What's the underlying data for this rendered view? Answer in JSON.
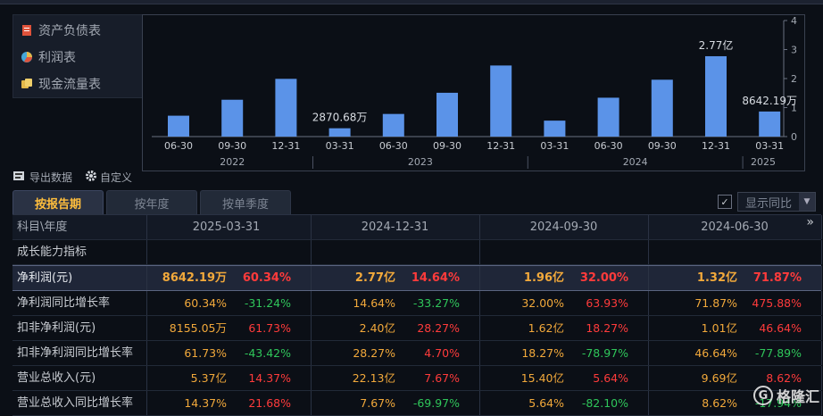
{
  "sidebar": {
    "items": [
      {
        "label": "资产负债表",
        "icon": "balance-sheet-icon",
        "color": "#e0533b"
      },
      {
        "label": "利润表",
        "icon": "income-statement-icon",
        "color": "#43a6d8"
      },
      {
        "label": "现金流量表",
        "icon": "cash-flow-icon",
        "color": "#e3b84a"
      }
    ]
  },
  "toolbar": {
    "export_label": "导出数据",
    "customize_label": "自定义"
  },
  "tabs": [
    {
      "label": "按报告期",
      "active": true
    },
    {
      "label": "按年度",
      "active": false
    },
    {
      "label": "按单季度",
      "active": false
    }
  ],
  "yoy": {
    "checked": true,
    "label": "显示同比"
  },
  "chart_data": {
    "type": "bar",
    "categories": [
      "06-30",
      "09-30",
      "12-31",
      "03-31",
      "06-30",
      "09-30",
      "12-31",
      "03-31",
      "06-30",
      "09-30",
      "12-31",
      "03-31"
    ],
    "years": [
      "2022",
      "2023",
      "2024",
      "2025"
    ],
    "values": [
      0.72,
      1.27,
      1.99,
      0.287,
      0.78,
      1.51,
      2.45,
      0.55,
      1.34,
      1.96,
      2.77,
      0.864
    ],
    "data_labels": {
      "3": "2870.68万",
      "10": "2.77亿",
      "11": "8642.19万"
    },
    "yticks": [
      "0",
      "1",
      "2",
      "3",
      "4"
    ],
    "ylim": [
      0,
      4
    ],
    "bar_color": "#5b93e8"
  },
  "table": {
    "corner_label": "科目\\年度",
    "columns": [
      "2025-03-31",
      "2024-12-31",
      "2024-09-30",
      "2024-06-30"
    ],
    "section_label": "成长能力指标",
    "rows": [
      {
        "label": "净利润(元)",
        "hl": true,
        "cells": [
          [
            "8642.19万",
            "60.34%",
            "red"
          ],
          [
            "2.77亿",
            "14.64%",
            "red"
          ],
          [
            "1.96亿",
            "32.00%",
            "red"
          ],
          [
            "1.32亿",
            "71.87%",
            "red"
          ]
        ]
      },
      {
        "label": "净利润同比增长率",
        "cells": [
          [
            "60.34%",
            "-31.24%",
            "green"
          ],
          [
            "14.64%",
            "-33.27%",
            "green"
          ],
          [
            "32.00%",
            "63.93%",
            "red"
          ],
          [
            "71.87%",
            "475.88%",
            "red"
          ]
        ]
      },
      {
        "label": "扣非净利润(元)",
        "cells": [
          [
            "8155.05万",
            "61.73%",
            "red"
          ],
          [
            "2.40亿",
            "28.27%",
            "red"
          ],
          [
            "1.62亿",
            "18.27%",
            "red"
          ],
          [
            "1.01亿",
            "46.64%",
            "red"
          ]
        ]
      },
      {
        "label": "扣非净利润同比增长率",
        "cells": [
          [
            "61.73%",
            "-43.42%",
            "green"
          ],
          [
            "28.27%",
            "4.70%",
            "red"
          ],
          [
            "18.27%",
            "-78.97%",
            "green"
          ],
          [
            "46.64%",
            "-77.89%",
            "green"
          ]
        ]
      },
      {
        "label": "营业总收入(元)",
        "cells": [
          [
            "5.37亿",
            "14.37%",
            "red"
          ],
          [
            "22.13亿",
            "7.67%",
            "red"
          ],
          [
            "15.40亿",
            "5.64%",
            "red"
          ],
          [
            "9.69亿",
            "8.62%",
            "red"
          ]
        ]
      },
      {
        "label": "营业总收入同比增长率",
        "cells": [
          [
            "14.37%",
            "21.68%",
            "red"
          ],
          [
            "7.67%",
            "-69.97%",
            "green"
          ],
          [
            "5.64%",
            "-82.10%",
            "green"
          ],
          [
            "8.62%",
            "-17.94%",
            "green"
          ]
        ]
      }
    ]
  },
  "watermark": "格隆汇"
}
